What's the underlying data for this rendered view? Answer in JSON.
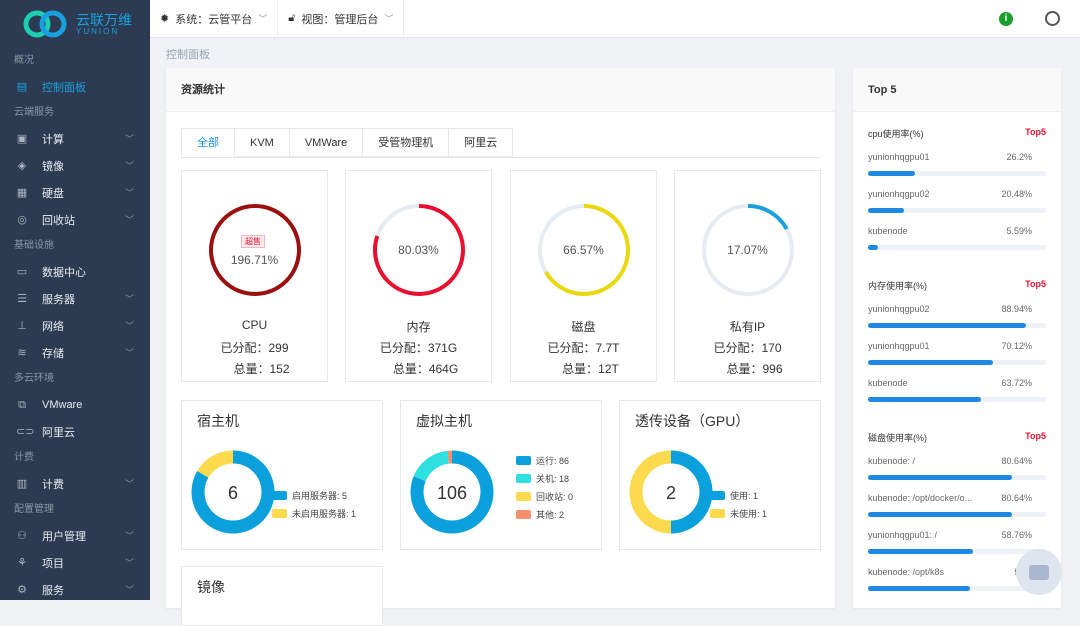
{
  "brand": {
    "name": "云联万维",
    "sub": "YUNION"
  },
  "topbar": {
    "system": "系统：云管平台",
    "view": "视图：管理后台"
  },
  "sidebar": [
    {
      "type": "sec",
      "label": "概况"
    },
    {
      "type": "item",
      "label": "控制面板",
      "icon": "dashboard-icon",
      "active": true
    },
    {
      "type": "sec",
      "label": "云端服务"
    },
    {
      "type": "item",
      "label": "计算",
      "icon": "compute-icon",
      "sub": true
    },
    {
      "type": "item",
      "label": "镜像",
      "icon": "image-icon",
      "sub": true
    },
    {
      "type": "item",
      "label": "硬盘",
      "icon": "disk-icon",
      "sub": true
    },
    {
      "type": "item",
      "label": "回收站",
      "icon": "recycle-icon",
      "sub": true
    },
    {
      "type": "sec",
      "label": "基础设施"
    },
    {
      "type": "item",
      "label": "数据中心",
      "icon": "datacenter-icon"
    },
    {
      "type": "item",
      "label": "服务器",
      "icon": "server-icon",
      "sub": true
    },
    {
      "type": "item",
      "label": "网络",
      "icon": "network-icon",
      "sub": true
    },
    {
      "type": "item",
      "label": "存储",
      "icon": "storage-icon",
      "sub": true
    },
    {
      "type": "sec",
      "label": "多云环境"
    },
    {
      "type": "item",
      "label": "VMware",
      "icon": "vmware-icon"
    },
    {
      "type": "item",
      "label": "阿里云",
      "icon": "aliyun-icon"
    },
    {
      "type": "sec",
      "label": "计费"
    },
    {
      "type": "item",
      "label": "计费",
      "icon": "billing-icon",
      "sub": true
    },
    {
      "type": "sec",
      "label": "配置管理"
    },
    {
      "type": "item",
      "label": "用户管理",
      "icon": "users-icon",
      "sub": true
    },
    {
      "type": "item",
      "label": "项目",
      "icon": "project-icon",
      "sub": true
    },
    {
      "type": "item",
      "label": "服务",
      "icon": "service-icon",
      "sub": true
    }
  ],
  "breadcrumb": "控制面板",
  "main": {
    "title": "资源统计",
    "tabs": [
      "全部",
      "KVM",
      "VMWare",
      "受管物理机",
      "阿里云"
    ],
    "stats": [
      {
        "name": "CPU",
        "pct": "196.71%",
        "value": 1.0,
        "color": "#9b0f0f",
        "badge": "超售",
        "alloc_label": "已分配：",
        "alloc": "299",
        "total_label": "总量：",
        "total": "152"
      },
      {
        "name": "内存",
        "pct": "80.03%",
        "value": 0.8003,
        "color": "#e8102e",
        "alloc_label": "已分配：",
        "alloc": "371G",
        "total_label": "总量：",
        "total": "464G"
      },
      {
        "name": "磁盘",
        "pct": "66.57%",
        "value": 0.6657,
        "color": "#e8d80c",
        "alloc_label": "已分配：",
        "alloc": "7.7T",
        "total_label": "总量：",
        "total": "12T"
      },
      {
        "name": "私有IP",
        "pct": "17.07%",
        "value": 0.1707,
        "color": "#1aa0e0",
        "alloc_label": "已分配：",
        "alloc": "170",
        "total_label": "总量：",
        "total": "996"
      }
    ],
    "donuts": [
      {
        "title": "宿主机",
        "center": "6",
        "segments": [
          {
            "label": "启用服务器: 5",
            "value": 5,
            "color": "#0aa0dc"
          },
          {
            "label": "未启用服务器: 1",
            "value": 1,
            "color": "#fdd94e"
          }
        ]
      },
      {
        "title": "虚拟主机",
        "center": "106",
        "segments": [
          {
            "label": "运行: 86",
            "value": 86,
            "color": "#0aa0dc"
          },
          {
            "label": "关机: 18",
            "value": 18,
            "color": "#2ee0e0"
          },
          {
            "label": "回收站: 0",
            "value": 0,
            "color": "#fdd94e"
          },
          {
            "label": "其他: 2",
            "value": 2,
            "color": "#f78f6f"
          }
        ]
      },
      {
        "title": "透传设备（GPU）",
        "center": "2",
        "segments": [
          {
            "label": "使用: 1",
            "value": 1,
            "color": "#0aa0dc"
          },
          {
            "label": "未使用: 1",
            "value": 1,
            "color": "#fdd94e"
          }
        ]
      }
    ],
    "image_card_title": "镜像"
  },
  "top5": {
    "title": "Top 5",
    "groups": [
      {
        "title": "cpu使用率(%)",
        "tag": "Top5",
        "rows": [
          {
            "name": "yunionhqgpu01",
            "pct": "26.2%",
            "value": 26.2
          },
          {
            "name": "yunionhqgpu02",
            "pct": "20.48%",
            "value": 20.48
          },
          {
            "name": "kubenode",
            "pct": "5.59%",
            "value": 5.59
          }
        ]
      },
      {
        "title": "内存使用率(%)",
        "tag": "Top5",
        "rows": [
          {
            "name": "yunionhqgpu02",
            "pct": "88.94%",
            "value": 88.94
          },
          {
            "name": "yunionhqgpu01",
            "pct": "70.12%",
            "value": 70.12
          },
          {
            "name": "kubenode",
            "pct": "63.72%",
            "value": 63.72
          }
        ]
      },
      {
        "title": "磁盘使用率(%)",
        "tag": "Top5",
        "rows": [
          {
            "name": "kubenode: /",
            "pct": "80.64%",
            "value": 80.64
          },
          {
            "name": "kubenode: /opt/docker/o...",
            "pct": "80.64%",
            "value": 80.64
          },
          {
            "name": "yunionhqgpu01: /",
            "pct": "58.76%",
            "value": 58.76
          },
          {
            "name": "kubenode: /opt/k8s",
            "pct": "57.4",
            "value": 57.4
          }
        ]
      }
    ]
  }
}
